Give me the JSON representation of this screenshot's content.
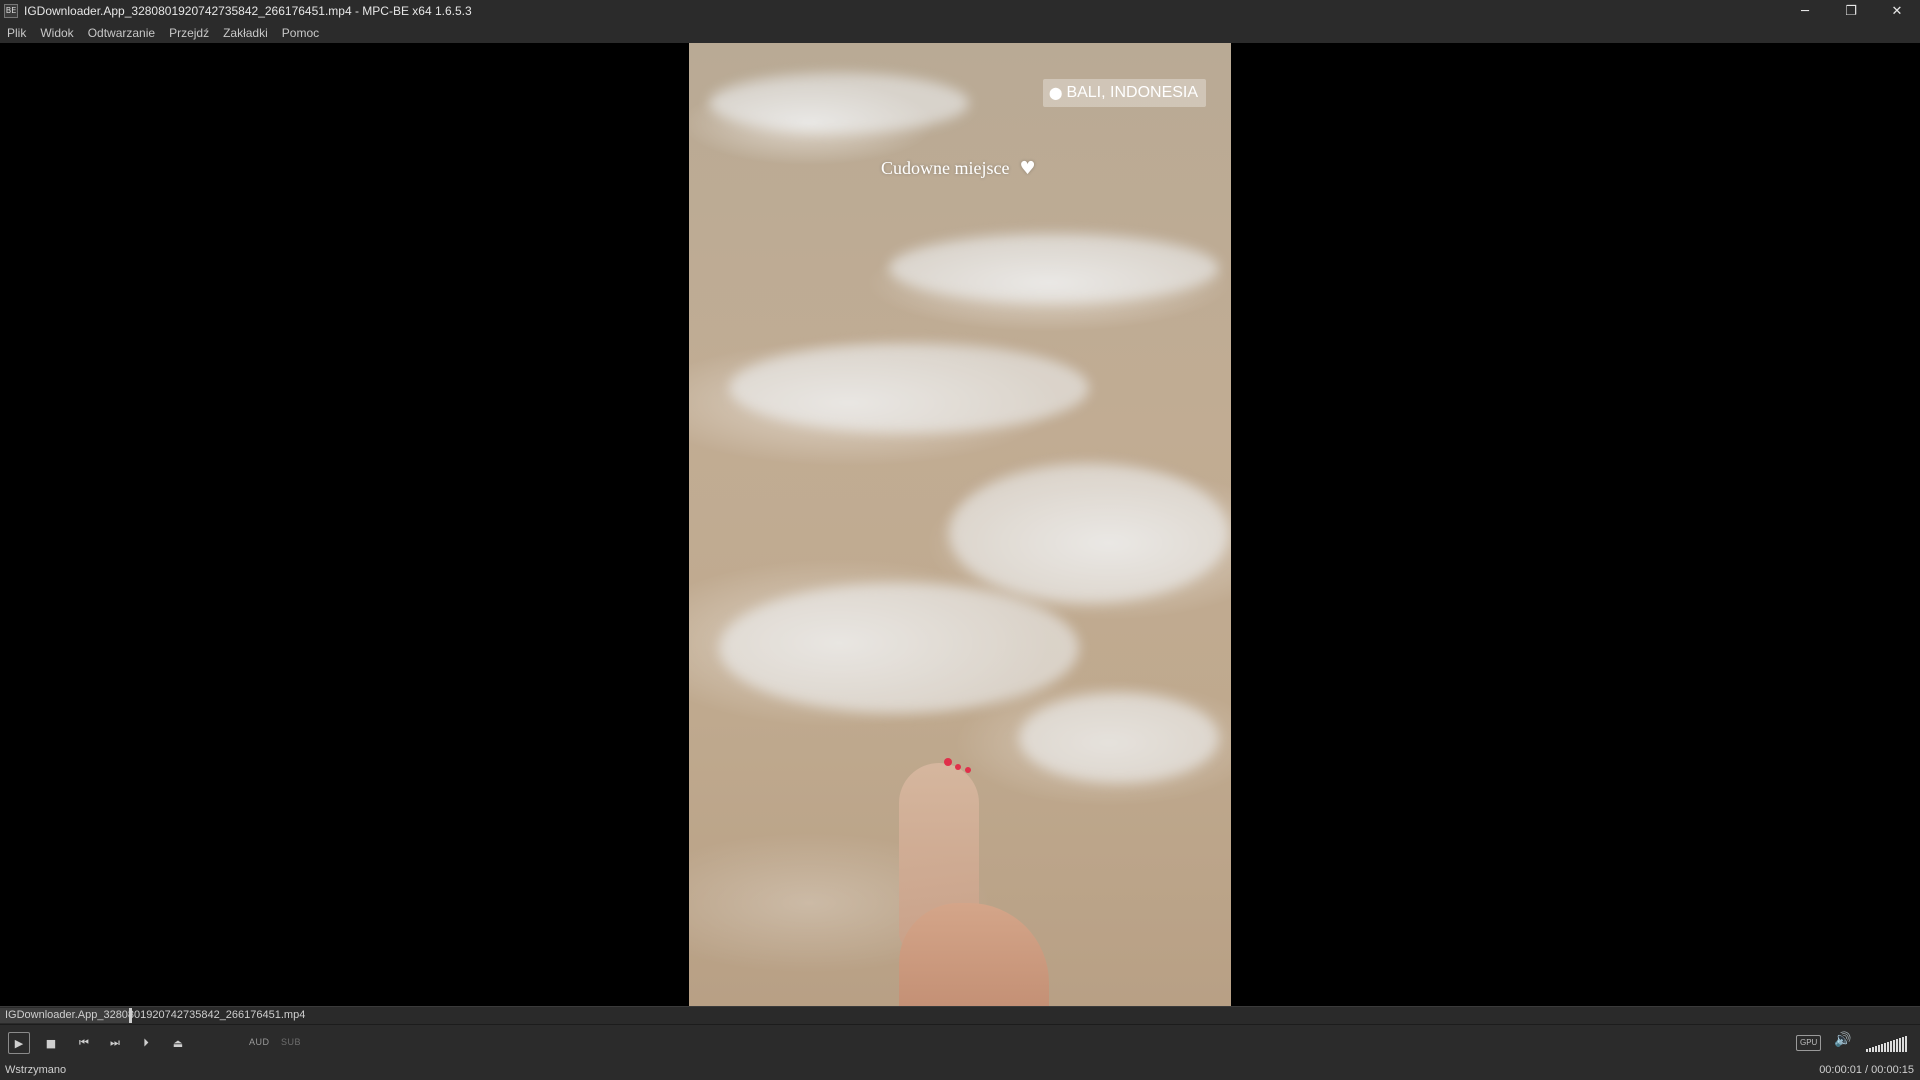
{
  "window": {
    "title": "IGDownloader.App_3280801920742735842_266176451.mp4 - MPC-BE x64 1.6.5.3",
    "app_icon_label": "BE",
    "minimize_glyph": "─",
    "restore_glyph": "❐",
    "close_glyph": "✕"
  },
  "menu": {
    "items": [
      {
        "label": "Plik"
      },
      {
        "label": "Widok"
      },
      {
        "label": "Odtwarzanie"
      },
      {
        "label": "Przejdź"
      },
      {
        "label": "Zakładki"
      },
      {
        "label": "Pomoc"
      }
    ]
  },
  "video": {
    "location_tag": "BALI, INDONESIA",
    "caption": "Cudowne miejsce"
  },
  "seekbar": {
    "filename": "IGDownloader.App_3280801920742735842_266176451.mp4",
    "position_fraction": 0.067
  },
  "toolbar": {
    "play_glyph": "▶",
    "stop_glyph": "■",
    "prev_glyph": "⏮",
    "next_glyph": "⏭",
    "frame_step_glyph": "⏵",
    "eject_glyph": "⏏",
    "audio_label": "AUD",
    "subtitle_label": "SUB",
    "gpu_label": "GPU",
    "volume_glyph": "🔊",
    "volume_level": 1.0
  },
  "status": {
    "state": "Wstrzymano",
    "time": "00:00:01 / 00:00:15"
  },
  "colors": {
    "chrome": "#2b2b2b",
    "video_bg": "#000000",
    "nail": "#e0304a"
  }
}
